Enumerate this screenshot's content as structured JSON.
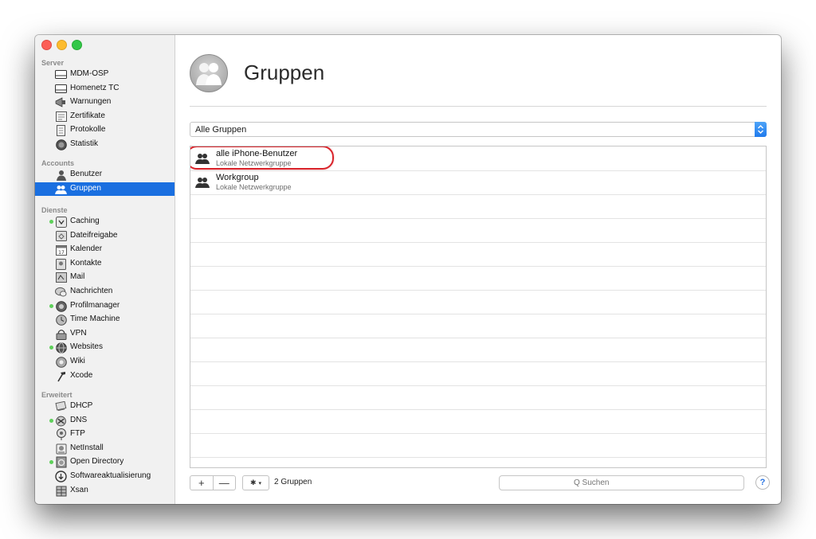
{
  "sidebar": {
    "sections": [
      {
        "title": "Server",
        "items": [
          {
            "label": "MDM-OSP",
            "icon": "server-icon",
            "active": false
          },
          {
            "label": "Homenetz TC",
            "icon": "server-icon",
            "active": false
          },
          {
            "label": "Warnungen",
            "icon": "megaphone-icon",
            "active": false
          },
          {
            "label": "Zertifikate",
            "icon": "certificate-icon",
            "active": false
          },
          {
            "label": "Protokolle",
            "icon": "document-icon",
            "active": false
          },
          {
            "label": "Statistik",
            "icon": "gauge-icon",
            "active": false
          }
        ]
      },
      {
        "title": "Accounts",
        "items": [
          {
            "label": "Benutzer",
            "icon": "user-icon",
            "active": false
          },
          {
            "label": "Gruppen",
            "icon": "group-icon",
            "active": false,
            "selected": true
          }
        ]
      },
      {
        "title": "Dienste",
        "items": [
          {
            "label": "Caching",
            "icon": "caching-icon",
            "active": true
          },
          {
            "label": "Dateifreigabe",
            "icon": "folder-icon",
            "active": false
          },
          {
            "label": "Kalender",
            "icon": "calendar-icon",
            "active": false
          },
          {
            "label": "Kontakte",
            "icon": "contacts-icon",
            "active": false
          },
          {
            "label": "Mail",
            "icon": "mail-icon",
            "active": false
          },
          {
            "label": "Nachrichten",
            "icon": "messages-icon",
            "active": false
          },
          {
            "label": "Profilmanager",
            "icon": "profile-manager-icon",
            "active": true
          },
          {
            "label": "Time Machine",
            "icon": "time-machine-icon",
            "active": false
          },
          {
            "label": "VPN",
            "icon": "vpn-icon",
            "active": false
          },
          {
            "label": "Websites",
            "icon": "globe-icon",
            "active": true
          },
          {
            "label": "Wiki",
            "icon": "wiki-icon",
            "active": false
          },
          {
            "label": "Xcode",
            "icon": "hammer-icon",
            "active": false
          }
        ]
      },
      {
        "title": "Erweitert",
        "items": [
          {
            "label": "DHCP",
            "icon": "dhcp-icon",
            "active": false
          },
          {
            "label": "DNS",
            "icon": "dns-icon",
            "active": true
          },
          {
            "label": "FTP",
            "icon": "ftp-icon",
            "active": false
          },
          {
            "label": "NetInstall",
            "icon": "netinstall-icon",
            "active": false
          },
          {
            "label": "Open Directory",
            "icon": "open-directory-icon",
            "active": true
          },
          {
            "label": "Softwareaktualisierung",
            "icon": "software-update-icon",
            "active": false
          },
          {
            "label": "Xsan",
            "icon": "xsan-icon",
            "active": false
          }
        ]
      }
    ]
  },
  "main": {
    "title": "Gruppen",
    "filter": {
      "selected": "Alle Gruppen"
    },
    "groups": [
      {
        "name": "alle iPhone-Benutzer",
        "type": "Lokale Netzwerkgruppe",
        "highlighted": true
      },
      {
        "name": "Workgroup",
        "type": "Lokale Netzwerkgruppe",
        "highlighted": false
      }
    ],
    "empty_rows": 11,
    "footer": {
      "add_label": "+",
      "remove_label": "—",
      "count": "2 Gruppen",
      "search_placeholder": "Q Suchen",
      "help_label": "?"
    }
  },
  "colors": {
    "selection": "#1a6fe0",
    "service_active": "#5ed05a",
    "highlight_ring": "#d9232a"
  }
}
